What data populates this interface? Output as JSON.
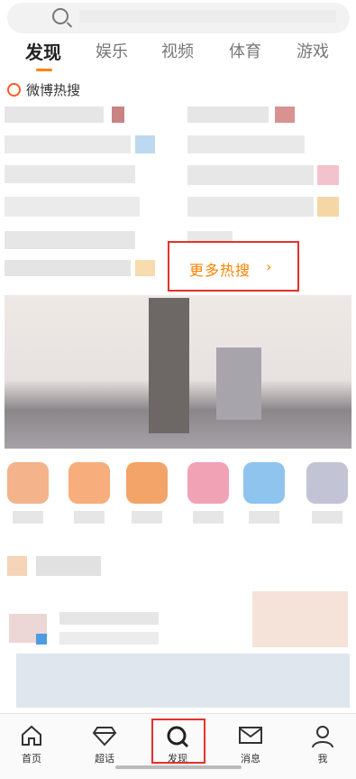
{
  "tabs": [
    {
      "label": "发现"
    },
    {
      "label": "娱乐"
    },
    {
      "label": "视频"
    },
    {
      "label": "体育"
    },
    {
      "label": "游戏"
    }
  ],
  "hot_search": {
    "title": "微博热搜",
    "more_label": "更多热搜",
    "more_chevron": "›"
  },
  "bottom_nav": [
    {
      "label": "首页",
      "icon": "home-icon"
    },
    {
      "label": "超话",
      "icon": "diamond-icon"
    },
    {
      "label": "发现",
      "icon": "discover-icon"
    },
    {
      "label": "消息",
      "icon": "mail-icon"
    },
    {
      "label": "我",
      "icon": "profile-icon"
    }
  ],
  "colors": {
    "accent": "#ff8200",
    "highlight": "#e5312c",
    "text": "#333333"
  }
}
